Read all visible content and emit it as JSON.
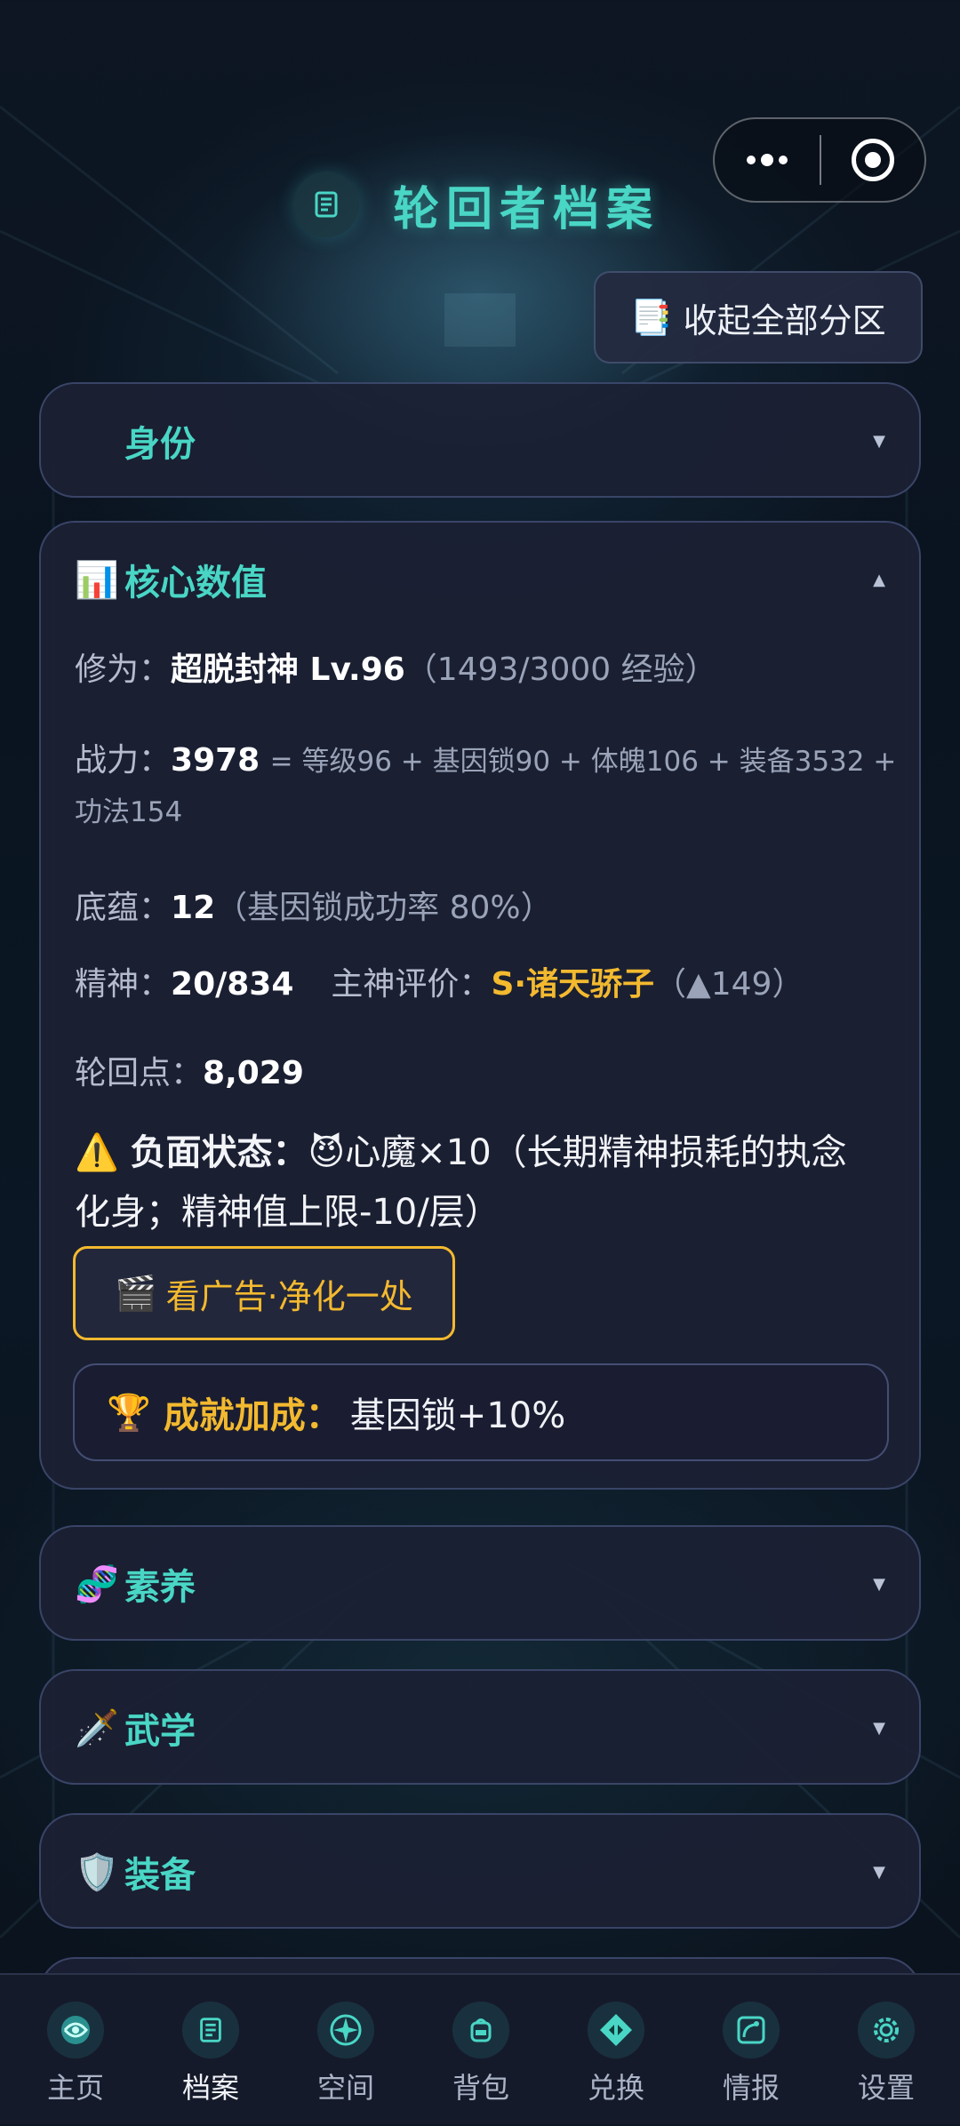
{
  "capsule": {
    "more_icon": "more-dots-icon",
    "close_icon": "target-icon"
  },
  "header": {
    "title": "轮回者档案",
    "title_icon": "scroll-icon",
    "collapse_all_icon": "bookmark-tabs-icon",
    "collapse_all_label": "收起全部分区"
  },
  "sections": {
    "identity": {
      "title": "身份",
      "expanded": false
    },
    "core": {
      "icon": "bar-chart-icon",
      "title": "核心数值",
      "expanded": true,
      "cultivation": {
        "label": "修为：",
        "value": "超脱封神 Lv.96",
        "sub": "（1493/3000 经验）"
      },
      "power": {
        "label": "战力：",
        "value": "3978",
        "formula": "= 等级96 + 基因锁90 + 体魄106 + 装备3532 +",
        "formula_cont": "功法154"
      },
      "foundation": {
        "label": "底蕴：",
        "value": "12",
        "sub": "（基因锁成功率 80%）"
      },
      "spirit": {
        "label": "精神：",
        "value": "20/834"
      },
      "rating": {
        "label": "主神评价：",
        "value": "S·诸天骄子",
        "sub": "（▲149）"
      },
      "points": {
        "label": "轮回点：",
        "value": "8,029"
      },
      "debuff": {
        "icon": "warning-icon",
        "label": "负面状态：",
        "emoji": "😈",
        "line1": "心魔×10（长期精神损耗的执念",
        "line2": "化身；精神值上限-10/层）"
      },
      "ad_button": {
        "icon": "clapper-icon",
        "label": "看广告·净化一处"
      },
      "achievement": {
        "icon": "trophy-icon",
        "label": "成就加成：",
        "value": "基因锁+10%"
      }
    },
    "literacy": {
      "icon": "dna-icon",
      "title": "素养",
      "expanded": false
    },
    "martial": {
      "icon": "dagger-icon",
      "title": "武学",
      "expanded": false
    },
    "equipment": {
      "icon": "shield-icon",
      "title": "装备",
      "expanded": false
    }
  },
  "tabbar": {
    "active": "档案",
    "tabs": [
      {
        "label": "主页",
        "icon": "swirl-icon"
      },
      {
        "label": "档案",
        "icon": "scroll-icon"
      },
      {
        "label": "空间",
        "icon": "compass-star-icon"
      },
      {
        "label": "背包",
        "icon": "backpack-icon"
      },
      {
        "label": "兑换",
        "icon": "exchange-icon"
      },
      {
        "label": "情报",
        "icon": "satellite-icon"
      },
      {
        "label": "设置",
        "icon": "gear-icon"
      }
    ]
  },
  "colors": {
    "accent": "#49d6c5",
    "gold": "#f3b92f",
    "card": "#1c2034"
  }
}
